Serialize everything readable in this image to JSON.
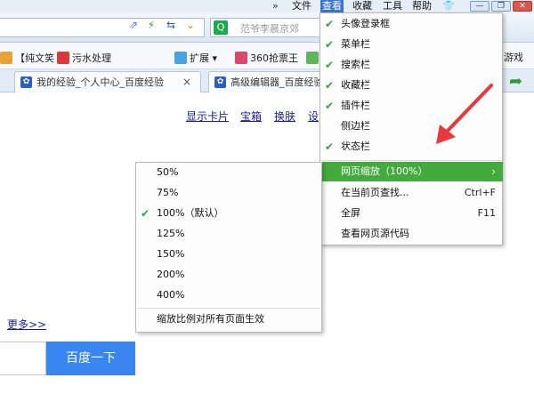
{
  "menubar": {
    "chevron": "»",
    "items": [
      "文件",
      "查看",
      "收藏",
      "工具",
      "帮助"
    ],
    "active_item": "查看",
    "skin_icon": "shirt-icon",
    "window_buttons": [
      "—",
      "❐",
      "✕"
    ]
  },
  "toolbar": {
    "search_placeholder": "范爷李晨京郊"
  },
  "bookmarks": [
    {
      "label": "【纯文笑",
      "icon": "bookmark-icon",
      "color": "#e7a23a"
    },
    {
      "label": "污水处理",
      "icon": "bookmark-icon",
      "color": "#d8393a"
    },
    {
      "label": "扩展",
      "icon": "extensions-icon",
      "color": "#4aa3df"
    },
    {
      "label": "360抢票王",
      "icon": "ticket-icon",
      "color": "#d84a6a"
    },
    {
      "label": "游戏",
      "icon": "game-icon",
      "color": "#888888"
    }
  ],
  "tabs": [
    {
      "title": "我的经验_个人中心_百度经验",
      "close": "×"
    },
    {
      "title": "高级编辑器_百度经验",
      "close": "×"
    }
  ],
  "page": {
    "top_links": [
      "显示卡片",
      "宝箱",
      "换肤",
      "设"
    ],
    "more_link": "更多>>",
    "search_button": "百度一下"
  },
  "view_menu": {
    "check_glyph": "✔",
    "items": [
      {
        "label": "头像登录框",
        "checked": true
      },
      {
        "label": "菜单栏",
        "checked": true
      },
      {
        "label": "搜索栏",
        "checked": true
      },
      {
        "label": "收藏栏",
        "checked": true
      },
      {
        "label": "插件栏",
        "checked": true
      },
      {
        "label": "侧边栏",
        "checked": false
      },
      {
        "label": "状态栏",
        "checked": true
      }
    ],
    "actions": [
      {
        "label": "网页缩放（100%）",
        "shortcut": "›",
        "highlighted": true
      },
      {
        "label": "在当前页查找...",
        "shortcut": "Ctrl+F",
        "highlighted": false
      },
      {
        "label": "全屏",
        "shortcut": "F11",
        "highlighted": false
      },
      {
        "label": "查看网页源代码",
        "shortcut": "",
        "highlighted": false
      }
    ]
  },
  "zoom_submenu": {
    "options": [
      {
        "label": "50%",
        "checked": false
      },
      {
        "label": "75%",
        "checked": false
      },
      {
        "label": "100%（默认）",
        "checked": true
      },
      {
        "label": "125%",
        "checked": false
      },
      {
        "label": "150%",
        "checked": false
      },
      {
        "label": "200%",
        "checked": false
      },
      {
        "label": "400%",
        "checked": false
      }
    ],
    "apply_all": "缩放比例对所有页面生效"
  },
  "colors": {
    "accent_green": "#43ab3d",
    "check_green": "#35a24a",
    "annotation_red": "#e8383d",
    "baidu_blue": "#3a86f0"
  }
}
